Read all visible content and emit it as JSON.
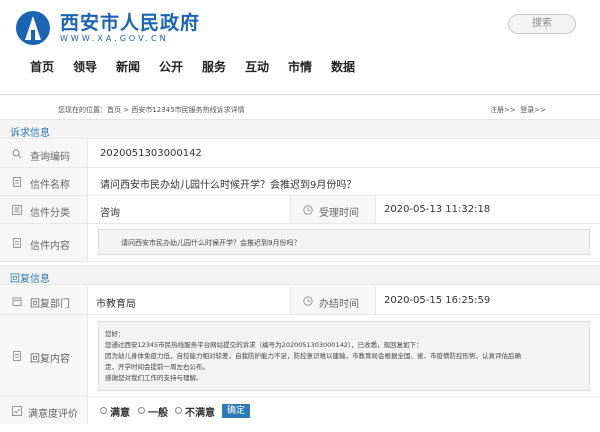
{
  "header": {
    "site_title": "西安市人民政府",
    "site_url": "WWW.XA.GOV.CN",
    "search_label": "搜索",
    "brand_color": "#1a64b5",
    "nav": [
      "首页",
      "领导",
      "新闻",
      "公开",
      "服务",
      "互动",
      "市情",
      "数据"
    ]
  },
  "breadcrumb": {
    "text": "您现在的位置：首页 > 西安市12345市民服务热线诉求详情",
    "register": "注册>>",
    "login": "登录>>"
  },
  "appeal": {
    "section_title": "诉求信息",
    "query_code_label": "查询编码",
    "query_code": "2020051303000142",
    "letter_name_label": "信件名称",
    "letter_name": "请问西安市民办幼儿园什么时候开学？会推迟到9月份吗？",
    "category_label": "信件分类",
    "category": "咨询",
    "accept_time_label": "受理时间",
    "accept_time": "2020-05-13 11:32:18",
    "content_label": "信件内容",
    "content": "请问西安市民办幼儿园什么时候开学？会推迟到9月份吗？"
  },
  "reply": {
    "section_title": "回复信息",
    "dept_label": "回复部门",
    "dept": "市教育局",
    "finish_time_label": "办结时间",
    "finish_time": "2020-05-15 16:25:59",
    "content_label": "回复内容",
    "content_lines": [
      "您好：",
      "您通过西安12345市民热线服务平台网站提交的诉求（编号为2020051303000142），已收悉，现回复如下：",
      "因为幼儿身体免疫力低，自控能力相对较差，自我防护能力不足，防控意识难以建输，市教育局会根据全国、省、市疫情防控形势，认真评估后确",
      "定，开学时间会提前一周左右公布。",
      "感谢您对我们工作的支持与理解。"
    ]
  },
  "rating": {
    "label": "满意度评价",
    "options": [
      "满意",
      "一般",
      "不满意"
    ],
    "confirm": "确定"
  }
}
